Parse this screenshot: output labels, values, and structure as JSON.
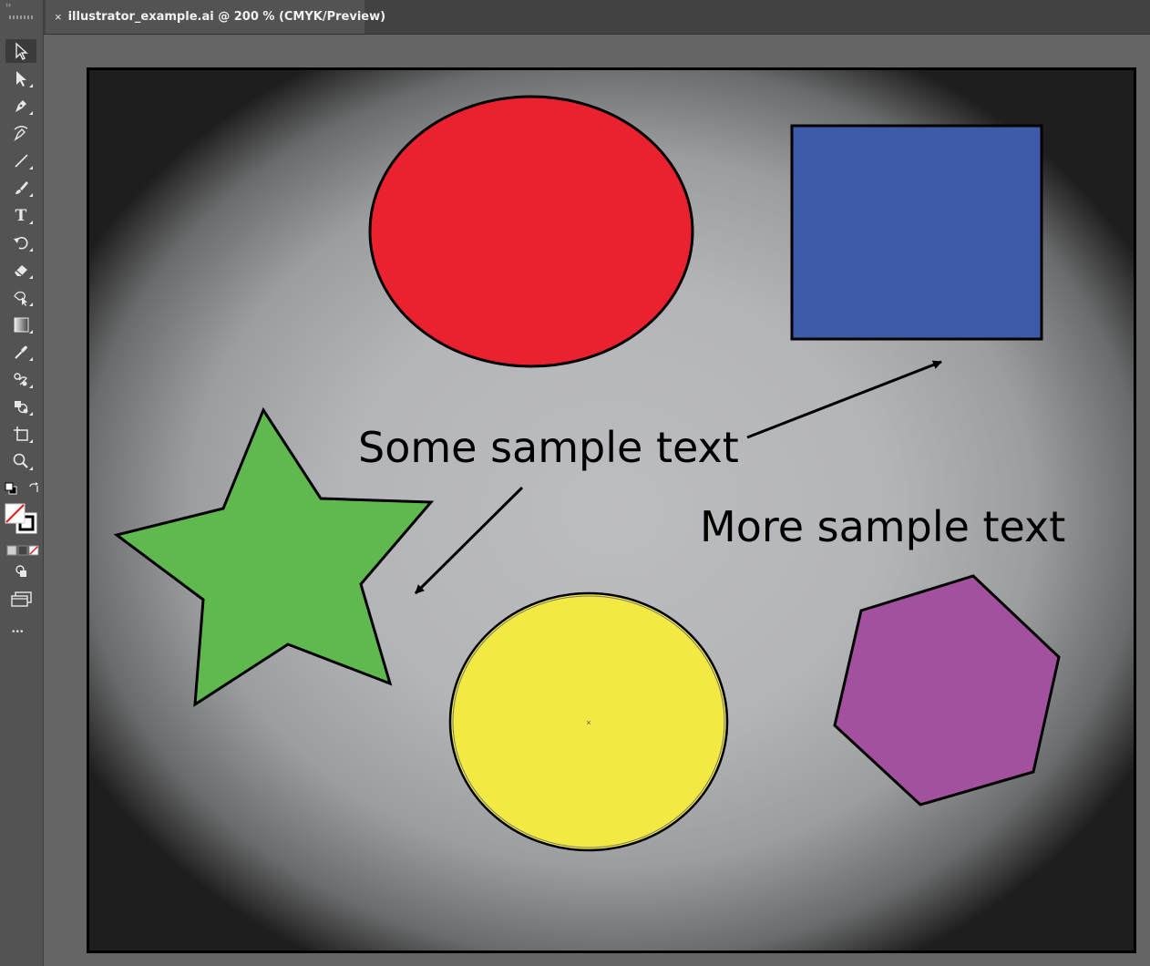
{
  "document_tab": {
    "close_glyph": "×",
    "title": "illustrator_example.ai @ 200 % (CMYK/Preview)"
  },
  "toolbar": {
    "tools": [
      {
        "name": "selection-tool",
        "icon": "arrow-icon"
      },
      {
        "name": "direct-selection-tool",
        "icon": "direct-arrow-icon"
      },
      {
        "name": "pen-tool",
        "icon": "pen-icon"
      },
      {
        "name": "curvature-tool",
        "icon": "curvature-icon"
      },
      {
        "name": "line-segment-tool",
        "icon": "line-icon"
      },
      {
        "name": "paintbrush-tool",
        "icon": "brush-icon"
      },
      {
        "name": "type-tool",
        "icon": "type-icon",
        "glyph": "T"
      },
      {
        "name": "rotate-tool",
        "icon": "rotate-icon"
      },
      {
        "name": "eraser-tool",
        "icon": "eraser-icon"
      },
      {
        "name": "free-transform-tool",
        "icon": "transform-icon"
      },
      {
        "name": "gradient-tool",
        "icon": "gradient-icon"
      },
      {
        "name": "eyedropper-tool",
        "icon": "eyedropper-icon"
      },
      {
        "name": "blend-tool",
        "icon": "blend-icon"
      },
      {
        "name": "shape-builder-tool",
        "icon": "shape-builder-icon"
      },
      {
        "name": "artboard-tool",
        "icon": "artboard-icon"
      },
      {
        "name": "zoom-tool",
        "icon": "zoom-icon"
      }
    ],
    "fill_color": "none",
    "stroke_color": "#000000",
    "more_glyph": "•••"
  },
  "artboard": {
    "shapes": [
      {
        "name": "red-ellipse",
        "type": "ellipse",
        "fill": "#ea212e"
      },
      {
        "name": "blue-rectangle",
        "type": "rect",
        "fill": "#3d5ba8"
      },
      {
        "name": "green-star",
        "type": "star",
        "fill": "#5fb94f"
      },
      {
        "name": "yellow-circle",
        "type": "ellipse",
        "fill": "#f2e942"
      },
      {
        "name": "purple-hexagon",
        "type": "polygon",
        "fill": "#a3519e"
      }
    ],
    "text_1": "Some sample text",
    "text_2": "More sample text"
  }
}
